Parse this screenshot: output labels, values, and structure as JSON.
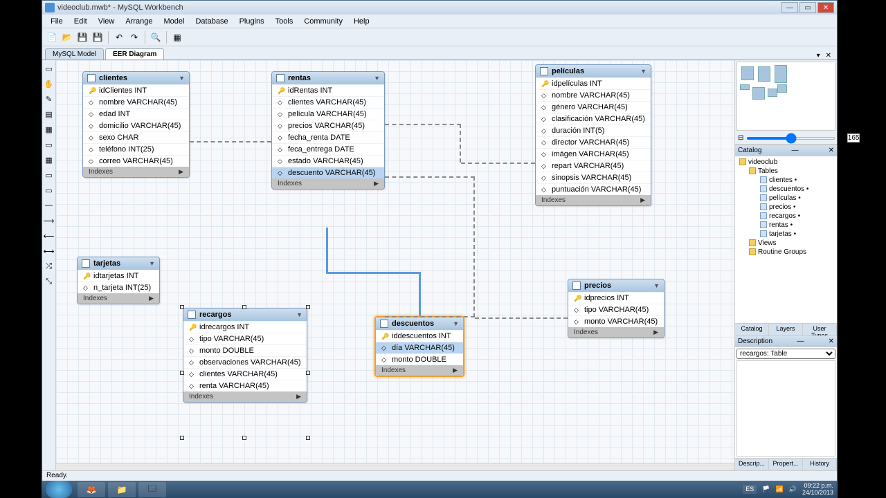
{
  "window": {
    "title": "videoclub.mwb* - MySQL Workbench"
  },
  "menu": [
    "File",
    "Edit",
    "View",
    "Arrange",
    "Model",
    "Database",
    "Plugins",
    "Tools",
    "Community",
    "Help"
  ],
  "tabs": {
    "model": "MySQL Model",
    "diagram": "EER Diagram"
  },
  "zoom": "165",
  "catalog": {
    "title": "Catalog",
    "db": "videoclub",
    "tablesLabel": "Tables",
    "tables": [
      "clientes •",
      "descuentos •",
      "películas •",
      "precios •",
      "recargos •",
      "rentas •",
      "tarjetas •"
    ],
    "views": "Views",
    "routines": "Routine Groups"
  },
  "sidetabs": [
    "Catalog",
    "Layers",
    "User Types"
  ],
  "description": {
    "title": "Description",
    "selected": "recargos: Table"
  },
  "bottomtabs": [
    "Descrip...",
    "Propert...",
    "History"
  ],
  "status": "Ready.",
  "tables": {
    "clientes": {
      "name": "clientes",
      "indexes": "Indexes",
      "cols": [
        "idClientes INT",
        "nombre VARCHAR(45)",
        "edad INT",
        "domicilio VARCHAR(45)",
        "sexo CHAR",
        "teléfono INT(25)",
        "correo VARCHAR(45)"
      ]
    },
    "rentas": {
      "name": "rentas",
      "indexes": "Indexes",
      "cols": [
        "idRentas INT",
        "clientes VARCHAR(45)",
        "película VARCHAR(45)",
        "precios VARCHAR(45)",
        "fecha_renta DATE",
        "feca_entrega DATE",
        "estado VARCHAR(45)",
        "descuento VARCHAR(45)"
      ]
    },
    "peliculas": {
      "name": "películas",
      "indexes": "Indexes",
      "cols": [
        "idpelículas INT",
        "nombre VARCHAR(45)",
        "género VARCHAR(45)",
        "clasificación VARCHAR(45)",
        "duración INT(5)",
        "director VARCHAR(45)",
        "imágen VARCHAR(45)",
        "repart VARCHAR(45)",
        "sinopsis VARCHAR(45)",
        "puntuación VARCHAR(45)"
      ]
    },
    "tarjetas": {
      "name": "tarjetas",
      "indexes": "Indexes",
      "cols": [
        "idtarjetas INT",
        "n_tarjeta INT(25)"
      ]
    },
    "recargos": {
      "name": "recargos",
      "indexes": "Indexes",
      "cols": [
        "idrecargos INT",
        "tipo VARCHAR(45)",
        "monto DOUBLE",
        "observaciones VARCHAR(45)",
        "clientes VARCHAR(45)",
        "renta VARCHAR(45)"
      ]
    },
    "descuentos": {
      "name": "descuentos",
      "indexes": "Indexes",
      "cols": [
        "iddescuentos INT",
        "día VARCHAR(45)",
        "monto DOUBLE"
      ]
    },
    "precios": {
      "name": "precios",
      "indexes": "Indexes",
      "cols": [
        "idprecios INT",
        "tipo VARCHAR(45)",
        "monto VARCHAR(45)"
      ]
    }
  },
  "taskbar": {
    "lang": "ES",
    "time": "09:22 p.m.",
    "date": "24/10/2013"
  }
}
